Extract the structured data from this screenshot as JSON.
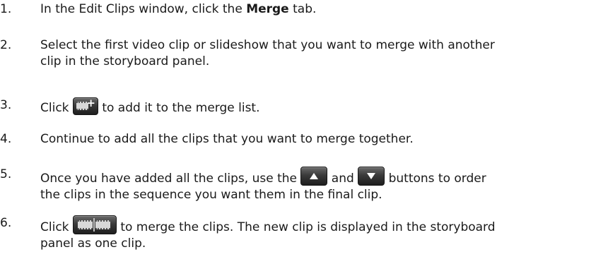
{
  "steps": [
    {
      "number": "1.",
      "text_a": "In the Edit Clips window, click the ",
      "bold": "Merge",
      "text_b": " tab."
    },
    {
      "number": "2.",
      "line1": "Select the first video clip or slideshow that you want to merge with another",
      "line2": "clip in the storyboard panel."
    },
    {
      "number": "3.",
      "text_a": "Click ",
      "icon": "add-to-merge-list-icon",
      "text_b": " to add it to the merge list."
    },
    {
      "number": "4.",
      "line1": "Continue to add all the clips that you want to merge together."
    },
    {
      "number": "5.",
      "text_a": "Once you have added all the clips, use the ",
      "icon_up": "move-up-icon",
      "text_mid": " and ",
      "icon_down": "move-down-icon",
      "text_b": " buttons to order",
      "line2": "the clips in the sequence you want them in the final clip."
    },
    {
      "number": "6.",
      "text_a": "Click ",
      "icon": "merge-clips-icon",
      "text_b": " to merge the clips. The new clip is displayed in the storyboard",
      "line2": "panel as one clip."
    }
  ],
  "colors": {
    "text": "#1a1a1a",
    "icon_dark": "#2b2b2b",
    "background": "#ffffff"
  }
}
